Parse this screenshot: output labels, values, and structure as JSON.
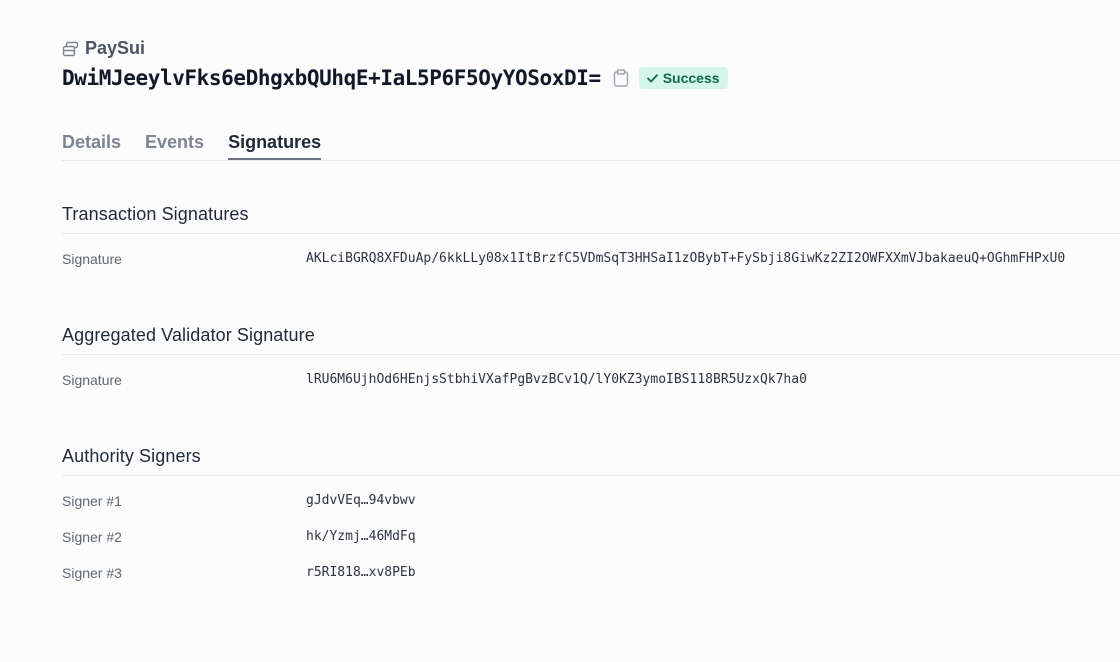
{
  "header": {
    "tx_type": "PaySui",
    "tx_type_icon": "coins-icon",
    "tx_id": "DwiMJeeylvFks6eDhgxbQUhqE+IaL5P6F5OyYOSoxDI=",
    "copy_icon": "clipboard-icon",
    "status": "Success",
    "status_icon": "checkmark-icon",
    "status_color": "#0f6b4f",
    "status_bg": "#d5f5ea"
  },
  "tabs": [
    {
      "label": "Details",
      "active": false
    },
    {
      "label": "Events",
      "active": false
    },
    {
      "label": "Signatures",
      "active": true
    }
  ],
  "transaction_signatures": {
    "title": "Transaction Signatures",
    "label": "Signature",
    "value": "AKLciBGRQ8XFDuAp/6kkLLy08x1ItBrzfC5VDmSqT3HHSaI1zOBybT+FySbji8GiwKz2ZI2OWFXXmVJbakaeuQ+OGhmFHPxU0"
  },
  "aggregated_validator_signature": {
    "title": "Aggregated Validator Signature",
    "label": "Signature",
    "value": "lRU6M6UjhOd6HEnjsStbhiVXafPgBvzBCv1Q/lY0KZ3ymoIBS118BR5UzxQk7ha0"
  },
  "authority_signers": {
    "title": "Authority Signers",
    "signers": [
      {
        "label": "Signer #1",
        "value": "gJdvVEq…94vbwv"
      },
      {
        "label": "Signer #2",
        "value": "hk/Yzmj…46MdFq"
      },
      {
        "label": "Signer #3",
        "value": "r5RI818…xv8PEb"
      }
    ]
  }
}
